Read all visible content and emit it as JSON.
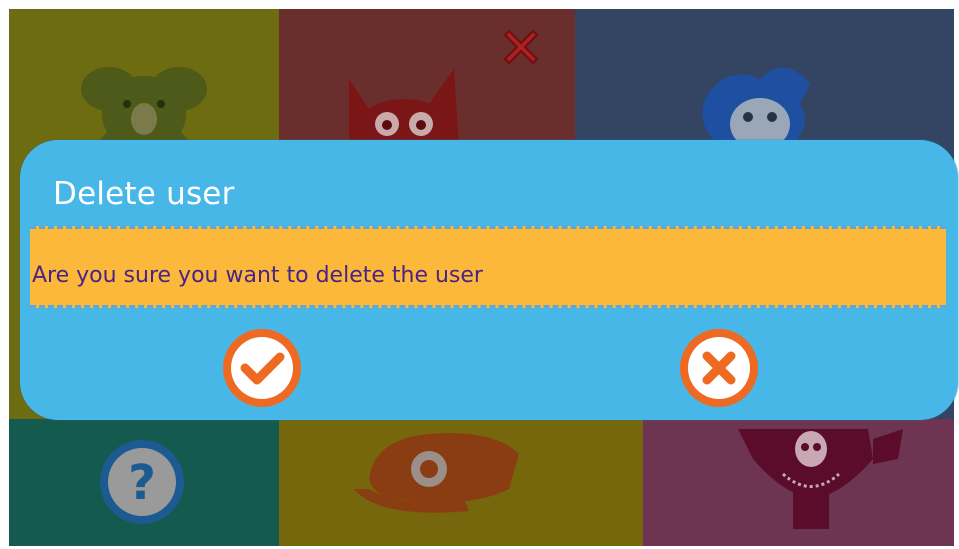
{
  "background": {
    "tiles": [
      {
        "name": "koala",
        "color": "#6d6c10"
      },
      {
        "name": "owl",
        "color": "#6a2e2d"
      },
      {
        "name": "monster",
        "color": "#344563"
      },
      {
        "name": "help",
        "color": "#145a4f"
      },
      {
        "name": "snail",
        "color": "#76670d"
      },
      {
        "name": "pirate",
        "color": "#6e3552"
      }
    ],
    "delete_tile_icon": "close-icon"
  },
  "dialog": {
    "title": "Delete user",
    "message": "Are you sure you want to delete the user",
    "confirm_icon": "check-icon",
    "cancel_icon": "close-icon",
    "colors": {
      "panel": "#47b7e8",
      "message_bg": "#fbb83b",
      "message_text": "#4a2485",
      "button_ring": "#ee6a22"
    }
  }
}
